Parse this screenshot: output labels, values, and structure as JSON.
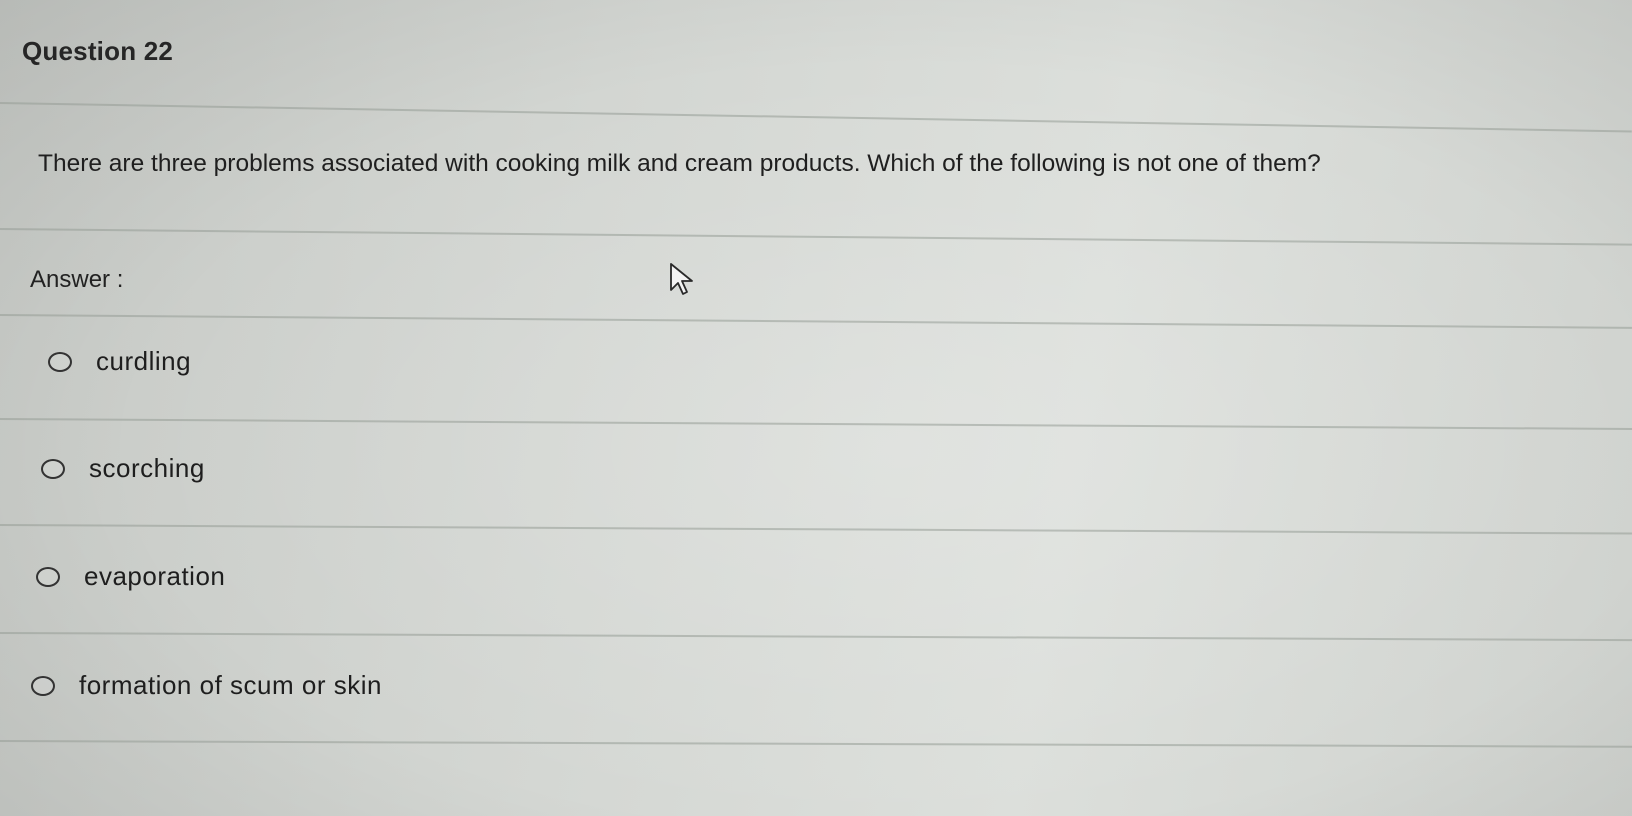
{
  "question": {
    "header": "Question 22",
    "text": "There are three problems associated with cooking milk and cream products. Which of the following is not one of them?"
  },
  "answer": {
    "label": "Answer :",
    "options": [
      {
        "label": "curdling",
        "selected": false
      },
      {
        "label": "scorching",
        "selected": false
      },
      {
        "label": "evaporation",
        "selected": false
      },
      {
        "label": "formation of scum or skin",
        "selected": false
      }
    ]
  },
  "colors": {
    "background": "#d5d8d4",
    "text": "#1f1f1f",
    "divider": "#9aa09a"
  },
  "icons": {
    "cursor": "mouse-pointer-icon",
    "radio": "radio-button-icon"
  }
}
